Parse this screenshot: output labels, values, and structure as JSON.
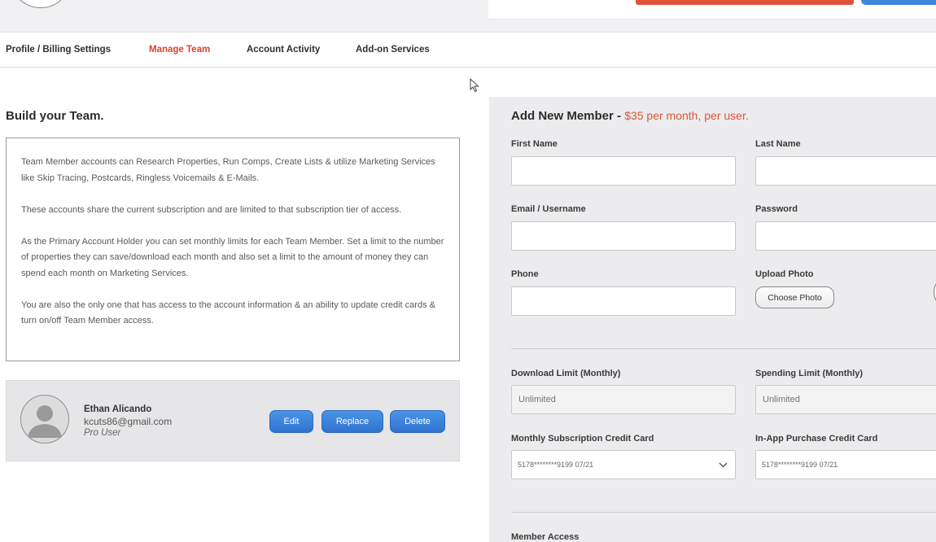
{
  "nav": {
    "tabs": [
      {
        "label": "Profile / Billing Settings",
        "active": false
      },
      {
        "label": "Manage Team",
        "active": true
      },
      {
        "label": "Account Activity",
        "active": false
      },
      {
        "label": "Add-on Services",
        "active": false
      }
    ]
  },
  "left": {
    "title": "Build your Team.",
    "paragraphs": [
      "Team Member accounts can Research Properties, Run Comps, Create Lists & utilize Marketing Services like Skip Tracing, Postcards, Ringless Voicemails & E-Mails.",
      "These accounts share the current subscription and are limited to that subscription tier of access.",
      "As the Primary Account Holder you can set monthly limits for each Team Member. Set a limit to the number of properties they can save/download each month and also set a limit to the amount of money they can spend each month on Marketing Services.",
      "You are also the only one that has access to the account information & an ability to update credit cards & turn on/off Team Member access."
    ],
    "member": {
      "name": "Ethan Alicando",
      "email": "kcuts86@gmail.com",
      "role": "Pro User",
      "edit_label": "Edit",
      "replace_label": "Replace",
      "delete_label": "Delete"
    }
  },
  "form": {
    "title": "Add New Member - ",
    "price": "$35 per month, per user.",
    "first_name_label": "First Name",
    "last_name_label": "Last Name",
    "email_label": "Email / Username",
    "password_label": "Password",
    "phone_label": "Phone",
    "upload_photo_label": "Upload Photo",
    "choose_photo_label": "Choose Photo",
    "download_limit_label": "Download Limit (Monthly)",
    "spending_limit_label": "Spending Limit (Monthly)",
    "download_limit_placeholder": "Unlimited",
    "spending_limit_placeholder": "Unlimited",
    "subscription_card_label": "Monthly Subscription Credit Card",
    "inapp_card_label": "In-App Purchase Credit Card",
    "subscription_card_value": "5178********9199 07/21",
    "inapp_card_value": "5178********9199 07/21",
    "member_access_label": "Member Access"
  },
  "colors": {
    "accent_red": "#d8452c",
    "button_blue": "#3a82d8",
    "panel_gray": "#ececee"
  }
}
